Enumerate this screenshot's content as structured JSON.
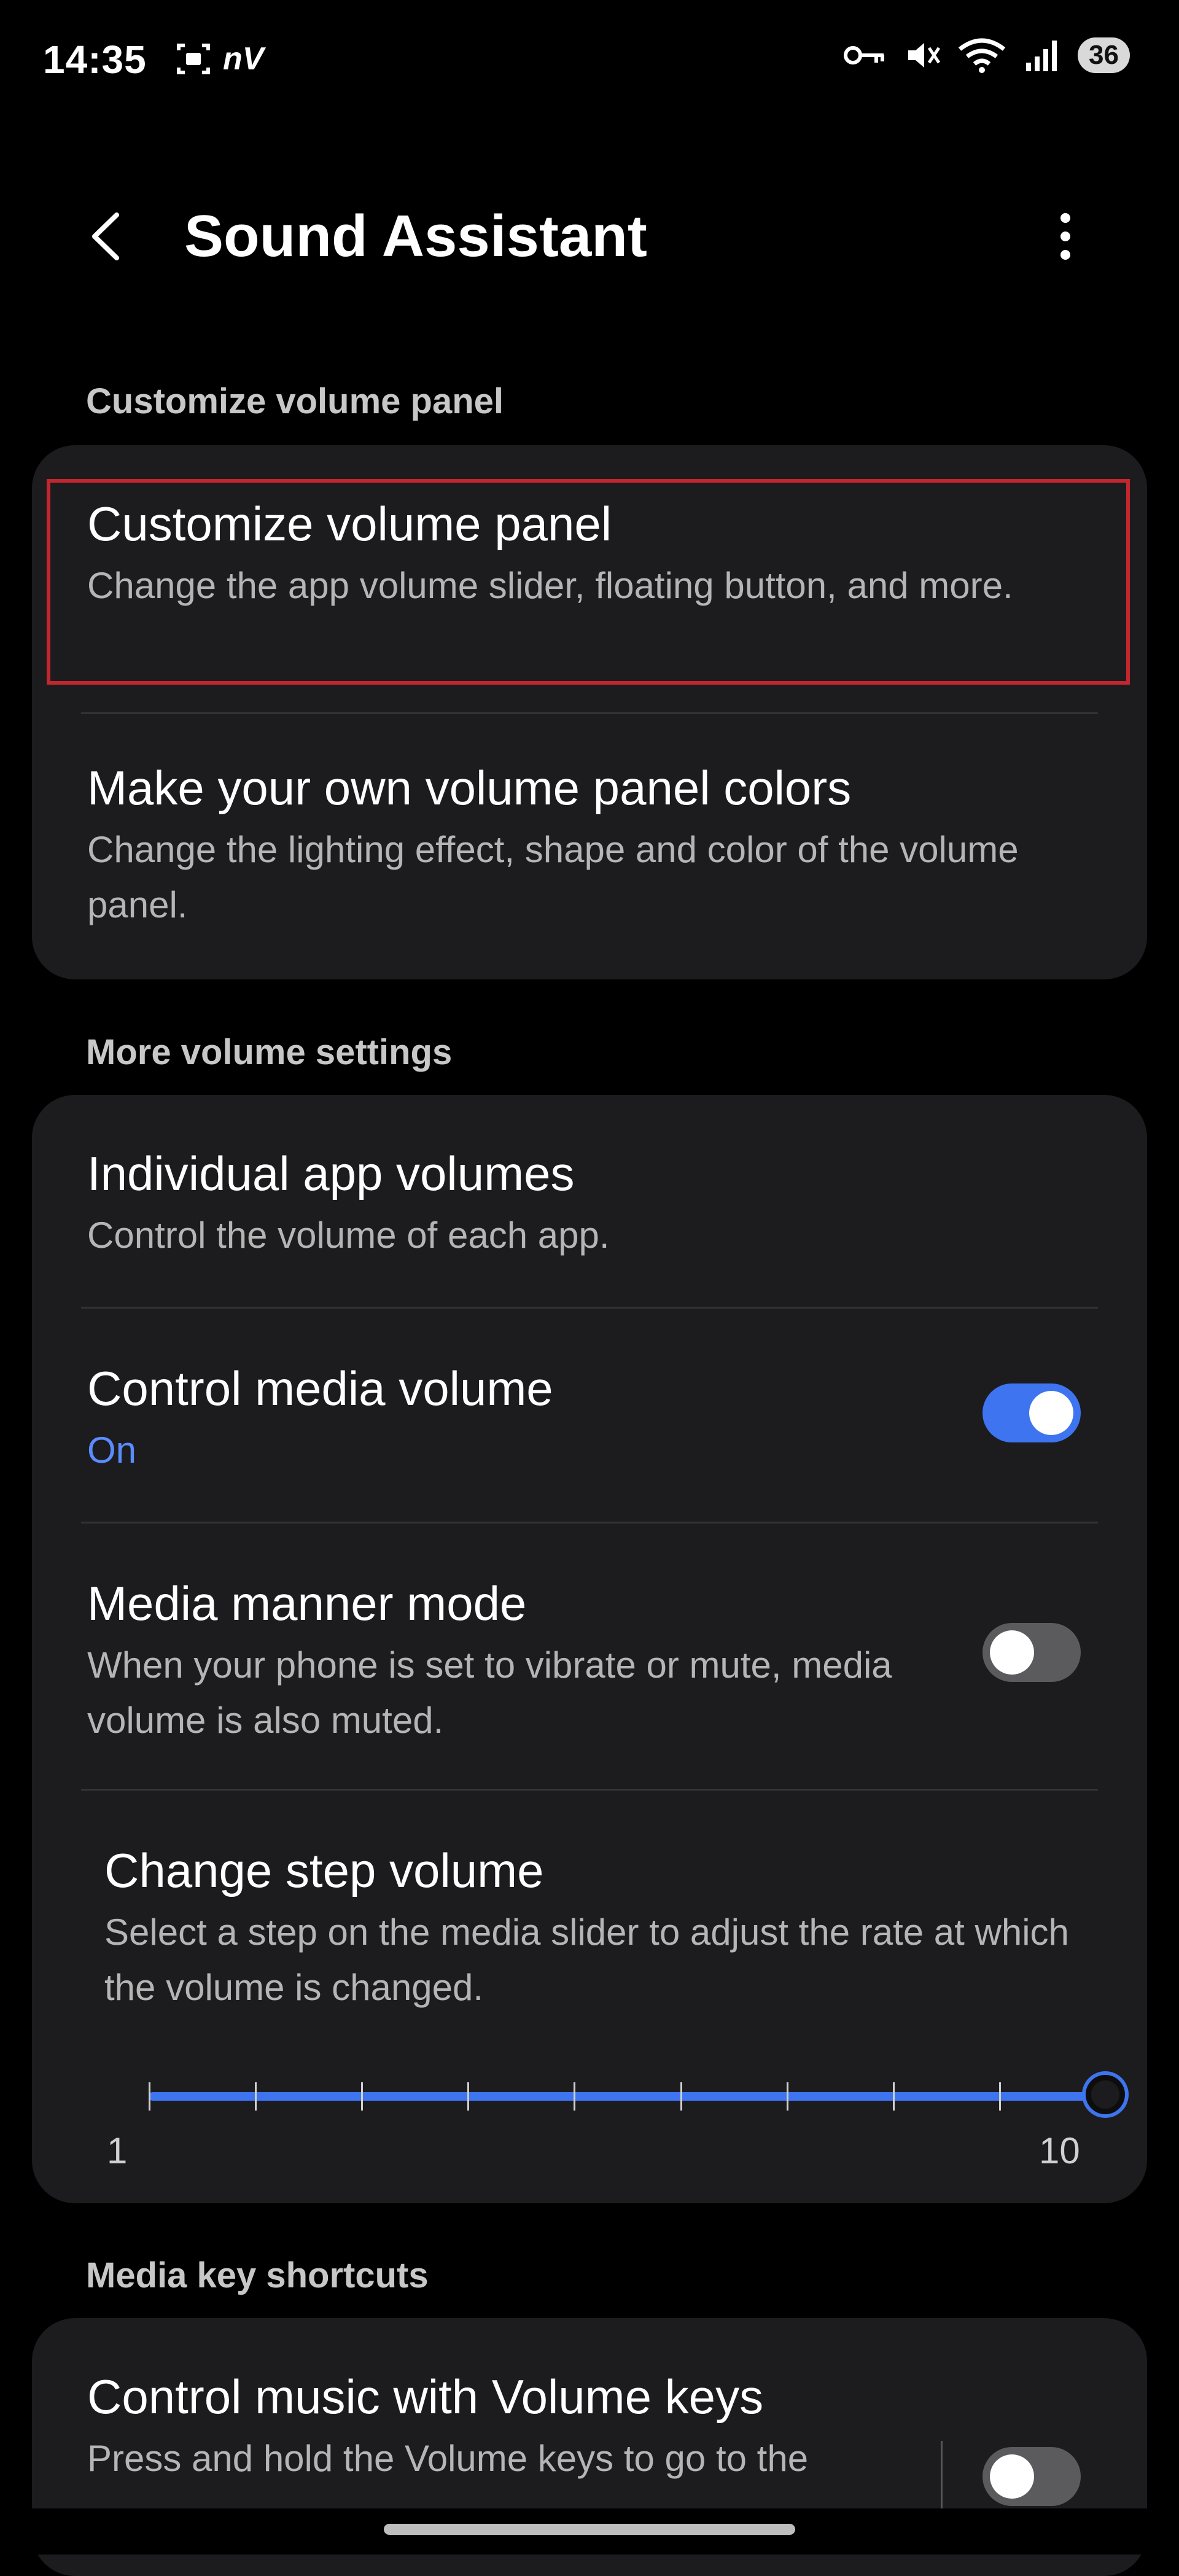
{
  "status_bar": {
    "time": "14:35",
    "net_label": "nV",
    "battery": "36",
    "icons": [
      "screen-record-icon",
      "key-icon",
      "mute-icon",
      "wifi-icon",
      "signal-icon"
    ]
  },
  "app_bar": {
    "title": "Sound Assistant",
    "back_icon": "chevron-left-icon",
    "more_icon": "more-vert-icon"
  },
  "sections": [
    {
      "header": "Customize volume panel",
      "items": [
        {
          "title": "Customize volume panel",
          "subtitle": "Change the app volume slider, floating button, and more."
        },
        {
          "title": "Make your own volume panel colors",
          "subtitle": "Change the lighting effect, shape and color of the volume panel."
        }
      ]
    },
    {
      "header": "More volume settings",
      "items": [
        {
          "title": "Individual app volumes",
          "subtitle": "Control the volume of each app."
        },
        {
          "title": "Control media volume",
          "subtitle": "On",
          "toggle": true
        },
        {
          "title": "Media manner mode",
          "subtitle": "When your phone is set to vibrate or mute, media volume is also muted.",
          "toggle": false
        },
        {
          "title": "Change step volume",
          "subtitle": "Select a step on the media slider to adjust the rate at which the volume is changed."
        }
      ],
      "slider": {
        "min_label": "1",
        "max_label": "10",
        "value": 10,
        "min": 1,
        "max": 10
      }
    },
    {
      "header": "Media key shortcuts",
      "items": [
        {
          "title": "Control music with Volume keys",
          "subtitle": "Press and hold the Volume keys to go to the",
          "toggle": false
        }
      ]
    }
  ],
  "colors": {
    "accent": "#3e74f0",
    "highlight_border": "#c2262e",
    "card_bg": "#1c1c1e"
  }
}
